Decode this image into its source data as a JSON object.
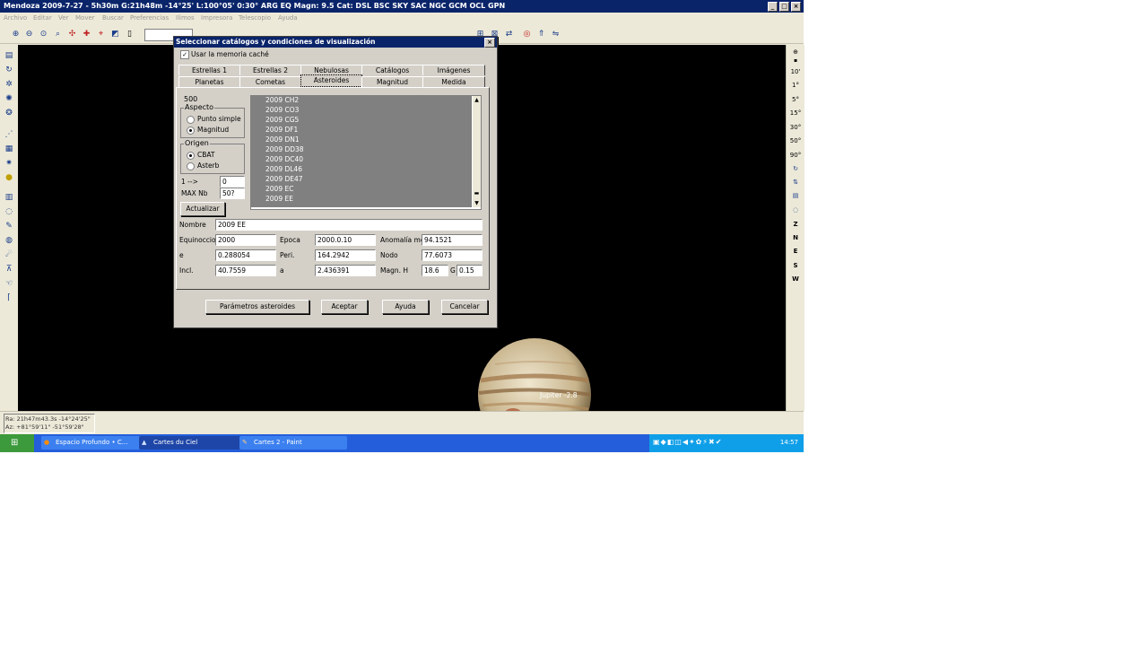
{
  "app": {
    "title": "Mendoza 2009-7-27 - 5h30m G:21h48m -14°25' L:100°05' 0:30° ARG EQ Magn: 9.5 Cat: DSL BSC SKY SAC NGC GCM OCL GPN",
    "menu": [
      "Archivo",
      "Editar",
      "Ver",
      "Mover",
      "Buscar",
      "Preferencias",
      "Ilimos",
      "Impresora",
      "Telescopio",
      "Ayuda"
    ]
  },
  "right_toolbar": {
    "fields": [
      "10'",
      "1°",
      "5°",
      "15°",
      "30°",
      "50°",
      "90°"
    ],
    "directions": [
      "Z",
      "N",
      "E",
      "S",
      "W"
    ]
  },
  "sky": {
    "planet_label": "Jupiter -2.8",
    "planet_color": "#c8b48c"
  },
  "status": {
    "line1": "Ra: 21h47m43.3s -14°24'25\"",
    "line2": "Az: +81°59'11\" -51°59'28\""
  },
  "taskbar": {
    "tasks": [
      "Espacio Profundo • C...",
      "Cartes du Ciel",
      "Cartes 2 - Paint"
    ],
    "clock": "14:57"
  },
  "dialog": {
    "title": "Seleccionar catálogos y condiciones de visualización",
    "close": "×",
    "memory_cache": {
      "label": "Usar la memoria caché",
      "checked": true
    },
    "tabs_row1": [
      "Estrellas 1",
      "Estrellas 2",
      "Nebulosas",
      "Catálogos",
      "Imágenes"
    ],
    "tabs_row2": [
      "Planetas",
      "Cometas",
      "Asteroides",
      "Magnitud",
      "Medida"
    ],
    "selected_tab": "Asteroides",
    "count": "500",
    "aspect": {
      "label": "Aspecto",
      "options": [
        "Punto simple",
        "Magnitud"
      ],
      "selected": "Magnitud"
    },
    "origin": {
      "label": "Origen",
      "options": [
        "CBAT",
        "Asterb"
      ],
      "selected": "CBAT"
    },
    "range_from_label": "1 -->",
    "range_from": "0",
    "range_max_label": "MAX Nb",
    "range_max": "50?",
    "update_button": "Actualizar",
    "list": [
      "2009 CH2",
      "2009 CO3",
      "2009 CG5",
      "2009 DF1",
      "2009 DN1",
      "2009 DD38",
      "2009 DC40",
      "2009 DL46",
      "2009 DE47",
      "2009 EC",
      "2009 EE"
    ],
    "fields": {
      "name_label": "Nombre",
      "name": "2009 EE",
      "equinox_label": "Equinoccio",
      "equinox": "2000",
      "epoch_label": "Epoca",
      "epoch": "2000.0.10",
      "anomaly_label": "Anomalía me",
      "anomaly": "94.1521",
      "e_label": "e",
      "e": "0.288054",
      "peri_label": "Peri.",
      "peri": "164.2942",
      "node_label": "Nodo",
      "node": "77.6073",
      "incl_label": "Incl.",
      "incl": "40.7559",
      "a_label": "a",
      "a": "2.436391",
      "magn_label": "Magn. H",
      "magn_h": "18.6",
      "g_label": "G",
      "magn_g": "0.15"
    },
    "buttons": {
      "params": "Parámetros asteroides",
      "accept": "Aceptar",
      "help": "Ayuda",
      "cancel": "Cancelar"
    }
  }
}
